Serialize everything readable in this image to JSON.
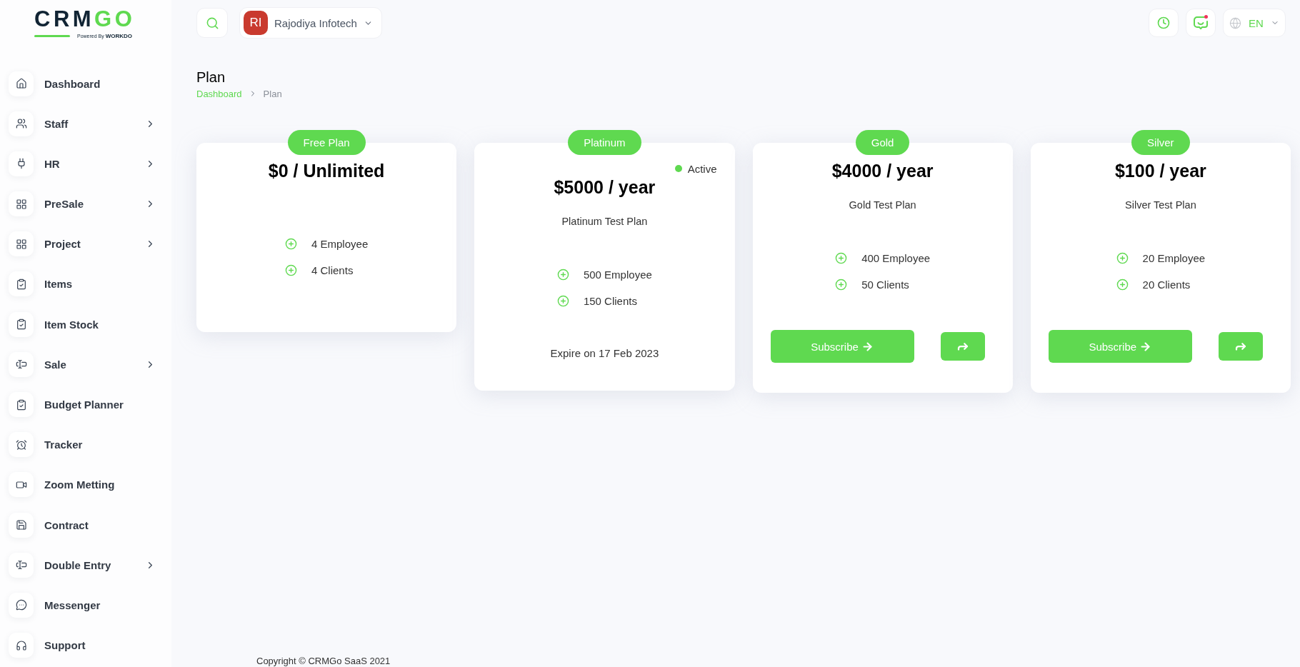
{
  "brand": {
    "name_dark": "CRM",
    "name_accent": "GO",
    "tagline": "Powered By **WORKDO**"
  },
  "sidebar": {
    "items": [
      {
        "label": "Dashboard",
        "expandable": false
      },
      {
        "label": "Staff",
        "expandable": true
      },
      {
        "label": "HR",
        "expandable": true
      },
      {
        "label": "PreSale",
        "expandable": true
      },
      {
        "label": "Project",
        "expandable": true
      },
      {
        "label": "Items",
        "expandable": false
      },
      {
        "label": "Item Stock",
        "expandable": false
      },
      {
        "label": "Sale",
        "expandable": true
      },
      {
        "label": "Budget Planner",
        "expandable": false
      },
      {
        "label": "Tracker",
        "expandable": false
      },
      {
        "label": "Zoom Metting",
        "expandable": false
      },
      {
        "label": "Contract",
        "expandable": false
      },
      {
        "label": "Double Entry",
        "expandable": true
      },
      {
        "label": "Messenger",
        "expandable": false
      },
      {
        "label": "Support",
        "expandable": false
      }
    ]
  },
  "topbar": {
    "company": {
      "initials": "RI",
      "name": "Rajodiya Infotech"
    },
    "chat_unread": true,
    "language": "EN"
  },
  "page": {
    "title": "Plan",
    "breadcrumb": [
      {
        "label": "Dashboard",
        "current": false
      },
      {
        "label": "Plan",
        "current": true
      }
    ]
  },
  "plans": [
    {
      "name": "Free Plan",
      "price": "$0 / Unlimited",
      "active": false,
      "features": [
        "4 Employee",
        "4 Clients"
      ]
    },
    {
      "name": "Platinum",
      "price": "$5000 / year",
      "active": true,
      "active_label": "Active",
      "description": "Platinum Test Plan",
      "features": [
        "500 Employee",
        "150 Clients"
      ],
      "footer": {
        "kind": "expiry",
        "text": "Expire on 17 Feb 2023"
      }
    },
    {
      "name": "Gold",
      "price": "$4000 / year",
      "active": false,
      "description": "Gold Test Plan",
      "features": [
        "400 Employee",
        "50 Clients"
      ],
      "footer": {
        "kind": "subscribe",
        "label": "Subscribe"
      }
    },
    {
      "name": "Silver",
      "price": "$100 / year",
      "active": false,
      "description": "Silver Test Plan",
      "features": [
        "20 Employee",
        "20 Clients"
      ],
      "footer": {
        "kind": "subscribe",
        "label": "Subscribe"
      }
    }
  ],
  "footer": {
    "copyright": "Copyright © CRMGo SaaS 2021"
  }
}
